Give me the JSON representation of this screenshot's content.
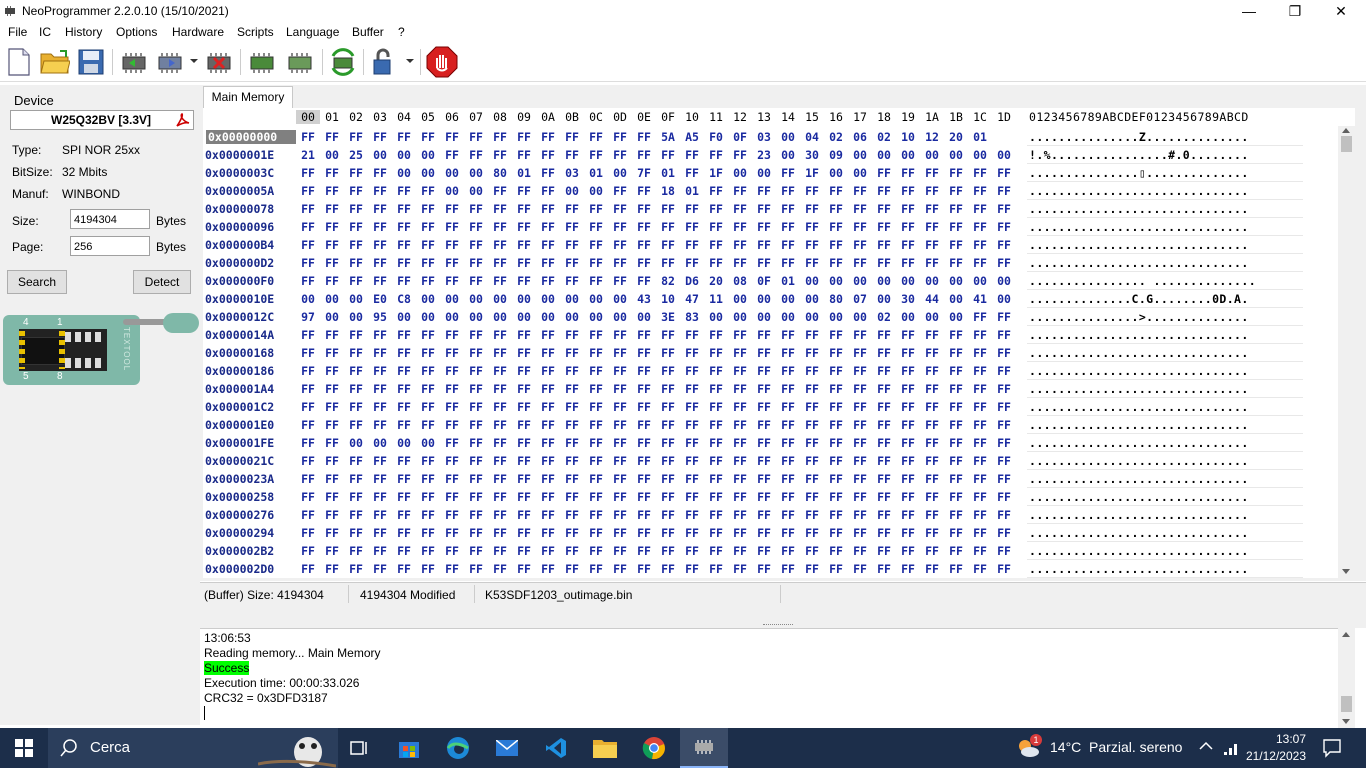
{
  "window": {
    "title": "NeoProgrammer 2.2.0.10 (15/10/2021)"
  },
  "menu": [
    "File",
    "IC",
    "History",
    "Options",
    "Hardware",
    "Scripts",
    "Language",
    "Buffer",
    "?"
  ],
  "device": {
    "section_label": "Device",
    "chip_name": "W25Q32BV [3.3V]",
    "type_label": "Type:",
    "type_value": "SPI NOR 25xx",
    "bitsize_label": "BitSize:",
    "bitsize_value": "32 Mbits",
    "manuf_label": "Manuf:",
    "manuf_value": "WINBOND",
    "size_label": "Size:",
    "size_value": "4194304",
    "size_unit": "Bytes",
    "page_label": "Page:",
    "page_value": "256",
    "page_unit": "Bytes",
    "search_button": "Search",
    "detect_button": "Detect",
    "socket_pin_labels": [
      "4",
      "1",
      "5",
      "8"
    ],
    "socket_brand": "TEXTOOL"
  },
  "tab": {
    "label": "Main Memory"
  },
  "hex": {
    "columns": [
      "00",
      "01",
      "02",
      "03",
      "04",
      "05",
      "06",
      "07",
      "08",
      "09",
      "0A",
      "0B",
      "0C",
      "0D",
      "0E",
      "0F",
      "10",
      "11",
      "12",
      "13",
      "14",
      "15",
      "16",
      "17",
      "18",
      "19",
      "1A",
      "1B",
      "1C",
      "1D"
    ],
    "ascii_header": "0123456789ABCDEF0123456789ABCD",
    "rows": [
      {
        "addr": "0x00000000",
        "bytes": "FF FF FF FF FF FF FF FF FF FF FF FF FF FF FF 5A A5 F0 0F 03 00 04 02 06 02 10 12 20 01",
        "ascii": "...............Z.............."
      },
      {
        "addr": "0x0000001E",
        "bytes": "21 00 25 00 00 00 FF FF FF FF FF FF FF FF FF FF FF FF FF 23 00 30 09 00 00 00 00 00 00 00",
        "ascii": "!.%................#.0........"
      },
      {
        "addr": "0x0000003C",
        "bytes": "FF FF FF FF 00 00 00 00 80 01 FF 03 01 00 7F 01 FF 1F 00 00 FF 1F 00 00 FF FF FF FF FF FF",
        "ascii": "...............▯.............."
      },
      {
        "addr": "0x0000005A",
        "bytes": "FF FF FF FF FF FF 00 00 FF FF FF 00 00 FF FF 18 01 FF FF FF FF FF FF FF FF FF FF FF FF FF",
        "ascii": ".............................."
      },
      {
        "addr": "0x00000078",
        "bytes": "FF FF FF FF FF FF FF FF FF FF FF FF FF FF FF FF FF FF FF FF FF FF FF FF FF FF FF FF FF FF",
        "ascii": ".............................."
      },
      {
        "addr": "0x00000096",
        "bytes": "FF FF FF FF FF FF FF FF FF FF FF FF FF FF FF FF FF FF FF FF FF FF FF FF FF FF FF FF FF FF",
        "ascii": ".............................."
      },
      {
        "addr": "0x000000B4",
        "bytes": "FF FF FF FF FF FF FF FF FF FF FF FF FF FF FF FF FF FF FF FF FF FF FF FF FF FF FF FF FF FF",
        "ascii": ".............................."
      },
      {
        "addr": "0x000000D2",
        "bytes": "FF FF FF FF FF FF FF FF FF FF FF FF FF FF FF FF FF FF FF FF FF FF FF FF FF FF FF FF FF FF",
        "ascii": ".............................."
      },
      {
        "addr": "0x000000F0",
        "bytes": "FF FF FF FF FF FF FF FF FF FF FF FF FF FF FF 82 D6 20 08 0F 01 00 00 00 00 00 00 00 00 00",
        "ascii": "................ .............."
      },
      {
        "addr": "0x0000010E",
        "bytes": "00 00 00 E0 C8 00 00 00 00 00 00 00 00 00 43 10 47 11 00 00 00 00 80 07 00 30 44 00 41 00",
        "ascii": "..............C.G........0D.A."
      },
      {
        "addr": "0x0000012C",
        "bytes": "97 00 00 95 00 00 00 00 00 00 00 00 00 00 00 3E 83 00 00 00 00 00 00 00 02 00 00 00 FF FF",
        "ascii": "...............>.............."
      },
      {
        "addr": "0x0000014A",
        "bytes": "FF FF FF FF FF FF FF FF FF FF FF FF FF FF FF FF FF FF FF FF FF FF FF FF FF FF FF FF FF FF",
        "ascii": ".............................."
      },
      {
        "addr": "0x00000168",
        "bytes": "FF FF FF FF FF FF FF FF FF FF FF FF FF FF FF FF FF FF FF FF FF FF FF FF FF FF FF FF FF FF",
        "ascii": ".............................."
      },
      {
        "addr": "0x00000186",
        "bytes": "FF FF FF FF FF FF FF FF FF FF FF FF FF FF FF FF FF FF FF FF FF FF FF FF FF FF FF FF FF FF",
        "ascii": ".............................."
      },
      {
        "addr": "0x000001A4",
        "bytes": "FF FF FF FF FF FF FF FF FF FF FF FF FF FF FF FF FF FF FF FF FF FF FF FF FF FF FF FF FF FF",
        "ascii": ".............................."
      },
      {
        "addr": "0x000001C2",
        "bytes": "FF FF FF FF FF FF FF FF FF FF FF FF FF FF FF FF FF FF FF FF FF FF FF FF FF FF FF FF FF FF",
        "ascii": ".............................."
      },
      {
        "addr": "0x000001E0",
        "bytes": "FF FF FF FF FF FF FF FF FF FF FF FF FF FF FF FF FF FF FF FF FF FF FF FF FF FF FF FF FF FF",
        "ascii": ".............................."
      },
      {
        "addr": "0x000001FE",
        "bytes": "FF FF 00 00 00 00 FF FF FF FF FF FF FF FF FF FF FF FF FF FF FF FF FF FF FF FF FF FF FF FF",
        "ascii": ".............................."
      },
      {
        "addr": "0x0000021C",
        "bytes": "FF FF FF FF FF FF FF FF FF FF FF FF FF FF FF FF FF FF FF FF FF FF FF FF FF FF FF FF FF FF",
        "ascii": ".............................."
      },
      {
        "addr": "0x0000023A",
        "bytes": "FF FF FF FF FF FF FF FF FF FF FF FF FF FF FF FF FF FF FF FF FF FF FF FF FF FF FF FF FF FF",
        "ascii": ".............................."
      },
      {
        "addr": "0x00000258",
        "bytes": "FF FF FF FF FF FF FF FF FF FF FF FF FF FF FF FF FF FF FF FF FF FF FF FF FF FF FF FF FF FF",
        "ascii": ".............................."
      },
      {
        "addr": "0x00000276",
        "bytes": "FF FF FF FF FF FF FF FF FF FF FF FF FF FF FF FF FF FF FF FF FF FF FF FF FF FF FF FF FF FF",
        "ascii": ".............................."
      },
      {
        "addr": "0x00000294",
        "bytes": "FF FF FF FF FF FF FF FF FF FF FF FF FF FF FF FF FF FF FF FF FF FF FF FF FF FF FF FF FF FF",
        "ascii": ".............................."
      },
      {
        "addr": "0x000002B2",
        "bytes": "FF FF FF FF FF FF FF FF FF FF FF FF FF FF FF FF FF FF FF FF FF FF FF FF FF FF FF FF FF FF",
        "ascii": ".............................."
      },
      {
        "addr": "0x000002D0",
        "bytes": "FF FF FF FF FF FF FF FF FF FF FF FF FF FF FF FF FF FF FF FF FF FF FF FF FF FF FF FF FF FF",
        "ascii": ".............................."
      }
    ]
  },
  "status": {
    "buffer_size": "(Buffer) Size: 4194304",
    "modified": "4194304 Modified",
    "filename": "K53SDF1203_outimage.bin"
  },
  "log": {
    "time": "13:06:53",
    "reading": "Reading memory... Main Memory",
    "success": "Success",
    "exec_time": "Execution time: 00:00:33.026",
    "crc": "CRC32 = 0x3DFD3187",
    "success_color": "#00ff00"
  },
  "taskbar": {
    "search_placeholder": "Cerca",
    "weather": "14°C  Parzial. sereno",
    "weather_badge": "1",
    "clock_time": "13:07",
    "clock_date": "21/12/2023"
  }
}
